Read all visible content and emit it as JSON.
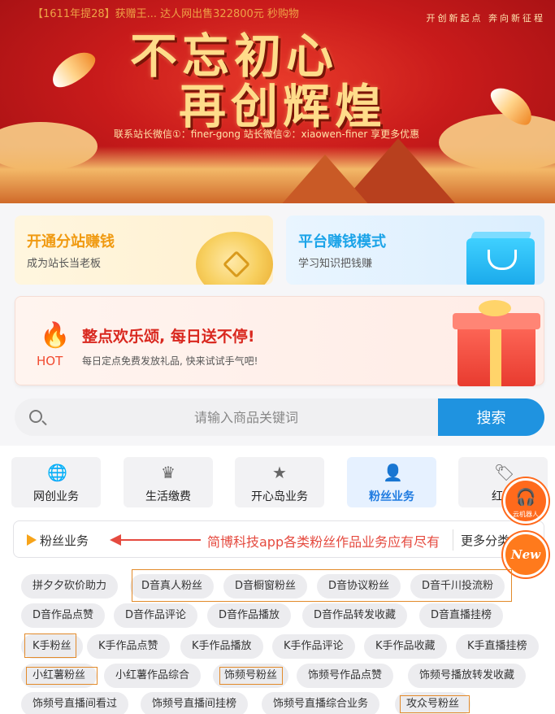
{
  "banner": {
    "marquee": "【1611年提28】获赠王... 达人网出售322800元 秒购物",
    "slogan": "开创新起点 奔向新征程",
    "title_line1": "不忘初心",
    "title_line2": "再创辉煌",
    "contact": "联系站长微信①：finer-gong   站长微信②：xiaowen-finer 享更多优惠"
  },
  "cards": [
    {
      "title": "开通分站赚钱",
      "subtitle": "成为站长当老板"
    },
    {
      "title": "平台赚钱模式",
      "subtitle": "学习知识把钱赚"
    }
  ],
  "hot": {
    "badge": "HOT",
    "title": "整点欢乐颂, 每日送不停!",
    "subtitle": "每日定点免费发放礼品, 快来试试手气吧!"
  },
  "search": {
    "placeholder": "请输入商品关键词",
    "button": "搜索"
  },
  "categories": [
    {
      "label": "网创业务",
      "icon": "globe-icon"
    },
    {
      "label": "生活缴费",
      "icon": "crown-icon"
    },
    {
      "label": "开心岛业务",
      "icon": "star-icon"
    },
    {
      "label": "粉丝业务",
      "icon": "user-chart-icon",
      "active": true
    },
    {
      "label": "红包",
      "icon": "tag-icon"
    }
  ],
  "floating": {
    "service_label": "云机器人",
    "new_label": "New"
  },
  "section": {
    "title": "粉丝业务",
    "annotation": "简博科技app各类粉丝作品业务应有尽有",
    "more": "更多分类"
  },
  "tags": [
    [
      "拼夕夕砍价助力",
      "D音真人粉丝",
      "D音橱窗粉丝",
      "D音协议粉丝",
      "D音千川投流粉"
    ],
    [
      "D音作品点赞",
      "D音作品评论",
      "D音作品播放",
      "D音作品转发收藏",
      "D音直播挂榜"
    ],
    [
      "K手粉丝",
      "K手作品点赞",
      "K手作品播放",
      "K手作品评论",
      "K手作品收藏",
      "K手直播挂榜"
    ],
    [
      "小红薯粉丝",
      "小红薯作品综合",
      "饰频号粉丝",
      "饰频号作品点赞",
      "饰频号播放转发收藏"
    ],
    [
      "饰频号直播间看过",
      "饰频号直播间挂榜",
      "饰频号直播综合业务",
      "攻众号粉丝"
    ]
  ],
  "colors": {
    "accent_blue": "#1f93e0",
    "hot_red": "#d9281f",
    "annotation_red": "#e54a3f",
    "highlight_orange": "#e28a2a"
  }
}
